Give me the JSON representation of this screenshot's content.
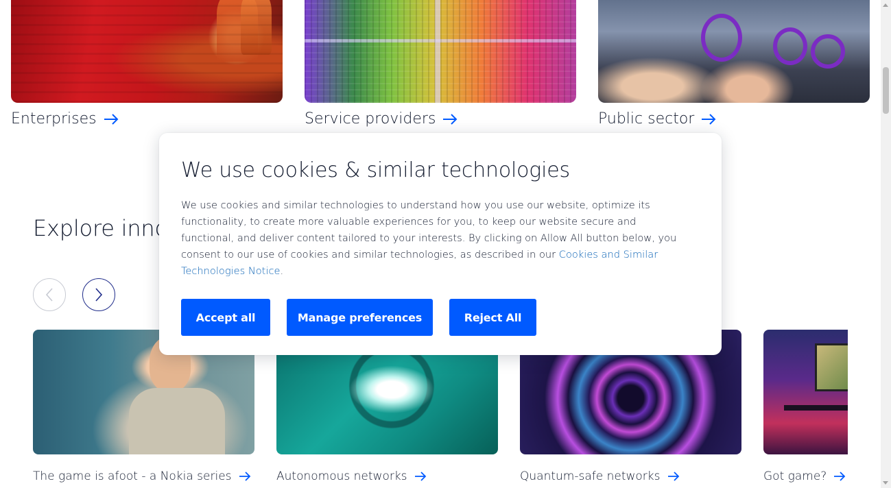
{
  "categories": [
    {
      "label": "Enterprises",
      "image": "workers-in-red-facility"
    },
    {
      "label": "Service providers",
      "image": "colorful-microchip"
    },
    {
      "label": "Public sector",
      "image": "subway-hand-grips"
    }
  ],
  "explore": {
    "title": "Explore innova",
    "prev_icon": "chevron-left-icon",
    "next_icon": "chevron-right-icon",
    "stories": [
      {
        "label": "The game is afoot - a Nokia series",
        "image": "man-in-city-street"
      },
      {
        "label": "Autonomous networks",
        "image": "teal-lightbulb-spiral"
      },
      {
        "label": "Quantum-safe networks",
        "image": "purple-particle-swirl"
      },
      {
        "label": "Got game?",
        "image": "gaming-desk-setup"
      }
    ]
  },
  "cookie_dialog": {
    "title": "We use cookies & similar technologies",
    "body": "We use cookies and similar technologies to understand how you use our website, optimize its functionality, to create more valuable experiences for you, to keep our website secure and functional, and deliver content tailored to your interests. By clicking on Allow All button below, you consent to our use of cookies and similar technologies, as described in our ",
    "link_text": "Cookies and Similar Technologies Notice",
    "body_end": ".",
    "buttons": {
      "accept": "Accept all",
      "manage": "Manage preferences",
      "reject": "Reject All"
    }
  },
  "colors": {
    "primary_button": "#005aff",
    "link": "#0a62b5",
    "text": "#121a2e",
    "arrow": "#005aff"
  }
}
